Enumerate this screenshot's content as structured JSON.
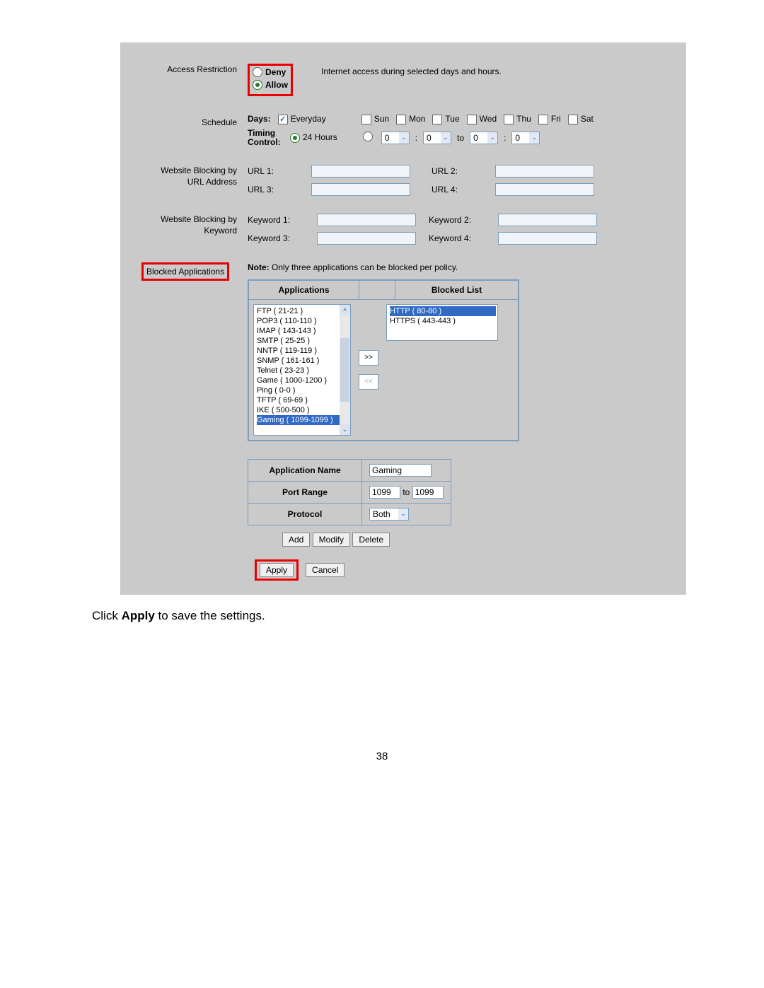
{
  "access_restriction": {
    "label": "Access Restriction",
    "deny": "Deny",
    "allow": "Allow",
    "selected": "allow",
    "help": "Internet access during selected days and hours."
  },
  "schedule": {
    "label": "Schedule",
    "days_label": "Days:",
    "everyday": "Everyday",
    "days": [
      "Sun",
      "Mon",
      "Tue",
      "Wed",
      "Thu",
      "Fri",
      "Sat"
    ],
    "timing_label": "Timing Control:",
    "twenty_four": "24 Hours",
    "from_h": "0",
    "from_m": "0",
    "to": "to",
    "to_h": "0",
    "to_m": "0"
  },
  "url_block": {
    "label": "Website Blocking by URL Address",
    "labels": [
      "URL 1:",
      "URL 2:",
      "URL 3:",
      "URL 4:"
    ]
  },
  "kw_block": {
    "label": "Website Blocking by Keyword",
    "labels": [
      "Keyword 1:",
      "Keyword 2:",
      "Keyword 3:",
      "Keyword 4:"
    ]
  },
  "blocked_apps": {
    "label": "Blocked Applications",
    "note_prefix": "Note:",
    "note_text": " Only three applications can be blocked per policy.",
    "col_apps": "Applications",
    "col_blocked": "Blocked List",
    "available": [
      "FTP ( 21-21 )",
      "POP3 ( 110-110 )",
      "IMAP ( 143-143 )",
      "SMTP ( 25-25 )",
      "NNTP ( 119-119 )",
      "SNMP ( 161-161 )",
      "Telnet ( 23-23 )",
      "Game ( 1000-1200 )",
      "Ping ( 0-0 )",
      "TFTP ( 69-69 )",
      "IKE ( 500-500 )",
      "Gaming ( 1099-1099 )"
    ],
    "selected_avail_index": 11,
    "blocked": [
      "HTTP ( 80-80 )",
      "HTTPS ( 443-443 )"
    ],
    "selected_blocked_index": 0,
    "add_arrow": ">>",
    "remove_arrow": "<<"
  },
  "app_form": {
    "name_label": "Application Name",
    "name_value": "Gaming",
    "port_label": "Port Range",
    "port_from": "1099",
    "port_to": "1099",
    "to": "to",
    "proto_label": "Protocol",
    "proto_value": "Both",
    "add": "Add",
    "modify": "Modify",
    "delete": "Delete"
  },
  "footer": {
    "apply": "Apply",
    "cancel": "Cancel"
  },
  "caption": {
    "pre": "Click ",
    "bold": "Apply",
    "post": " to save the settings."
  },
  "page_number": "38"
}
